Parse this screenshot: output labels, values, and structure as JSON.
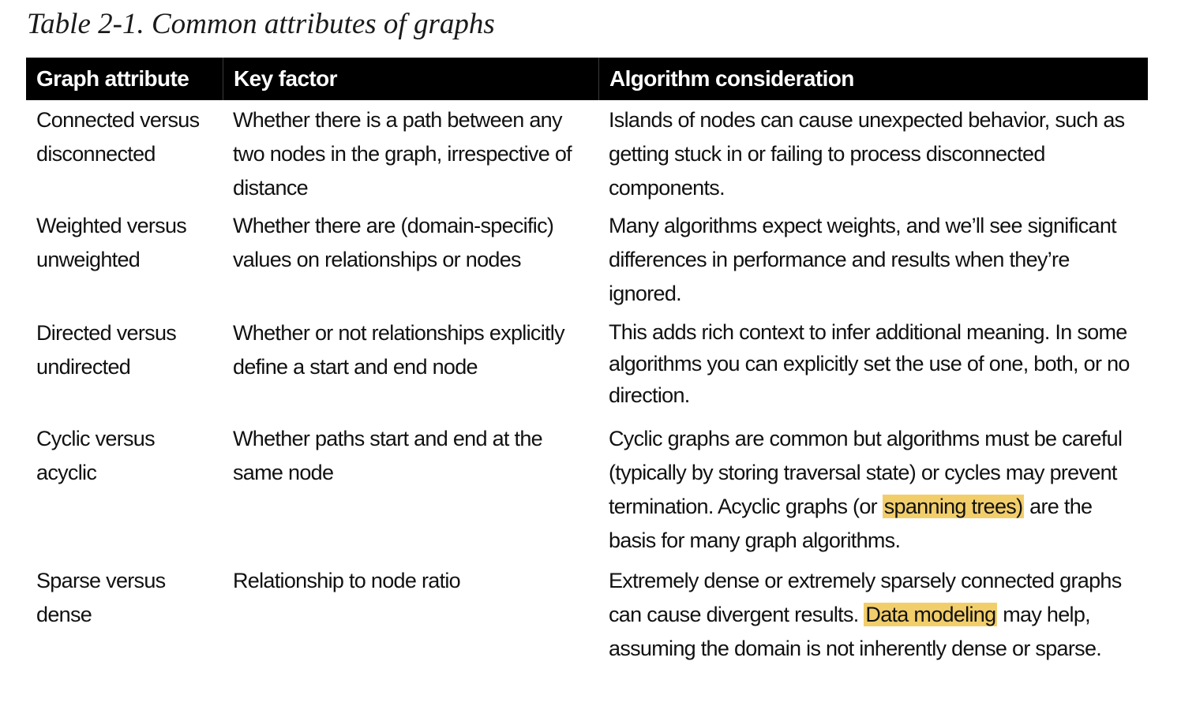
{
  "caption": "Table 2-1. Common attributes of graphs",
  "table": {
    "headers": [
      "Graph attribute",
      "Key factor",
      "Algorithm consideration"
    ],
    "rows": [
      {
        "attribute": "Connected versus disconnected",
        "key_factor": "Whether there is a path between any two nodes in the graph, irrespective of distance",
        "consideration": {
          "before": "Islands of nodes can cause unexpected behavior, such as getting stuck in or failing to process disconnected components.",
          "highlight": "",
          "after": ""
        }
      },
      {
        "attribute": "Weighted versus unweighted",
        "key_factor": "Whether there are (domain-specific) values on relationships or nodes",
        "consideration": {
          "before": "Many algorithms expect weights, and we’ll see significant differences in performance and results when they’re ignored.",
          "highlight": "",
          "after": ""
        }
      },
      {
        "attribute": "Directed versus undirected",
        "key_factor": "Whether or not relationships explicitly define a start and end node",
        "consideration": {
          "before": "This adds rich context to infer additional meaning. In some algorithms you can explicitly set the use of one, both, or no direction.",
          "highlight": "",
          "after": ""
        }
      },
      {
        "attribute": "Cyclic versus acyclic",
        "key_factor": "Whether paths start and end at the same node",
        "consideration": {
          "before": "Cyclic graphs are common but algorithms must be careful (typically by storing traversal state) or cycles may prevent termination. Acyclic graphs (or ",
          "highlight": "spanning trees)",
          "after": " are the basis for many graph algorithms."
        }
      },
      {
        "attribute": "Sparse versus dense",
        "key_factor": "Relationship to node ratio",
        "consideration": {
          "before": "Extremely dense or extremely sparsely connected graphs can cause divergent results. ",
          "highlight": "Data modeling",
          "after": " may help, assuming the domain is not inherently dense or sparse."
        }
      }
    ]
  },
  "colors": {
    "header_bg": "#000000",
    "header_text": "#ffffff",
    "highlight": "#f2ce6b"
  }
}
